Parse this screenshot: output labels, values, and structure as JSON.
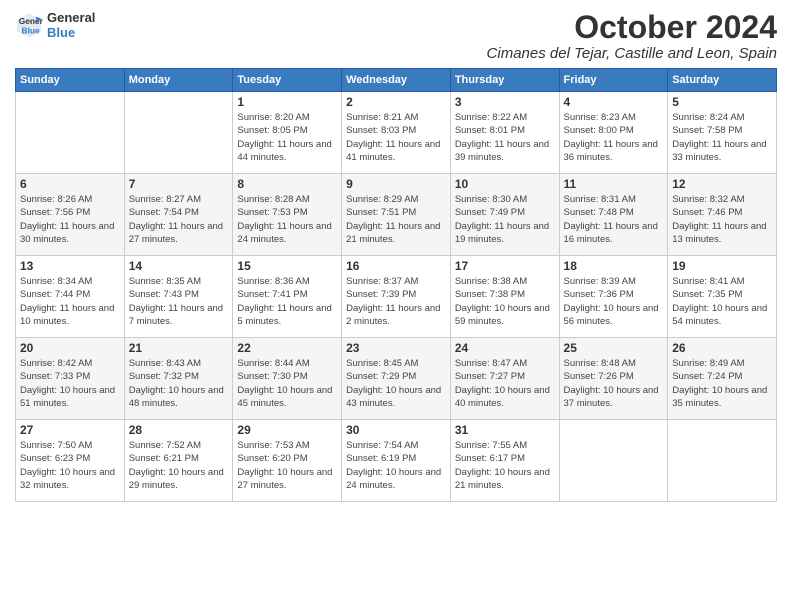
{
  "logo": {
    "line1": "General",
    "line2": "Blue"
  },
  "title": "October 2024",
  "subtitle": "Cimanes del Tejar, Castille and Leon, Spain",
  "days_of_week": [
    "Sunday",
    "Monday",
    "Tuesday",
    "Wednesday",
    "Thursday",
    "Friday",
    "Saturday"
  ],
  "weeks": [
    [
      {
        "day": "",
        "sunrise": "",
        "sunset": "",
        "daylight": ""
      },
      {
        "day": "",
        "sunrise": "",
        "sunset": "",
        "daylight": ""
      },
      {
        "day": "1",
        "sunrise": "Sunrise: 8:20 AM",
        "sunset": "Sunset: 8:05 PM",
        "daylight": "Daylight: 11 hours and 44 minutes."
      },
      {
        "day": "2",
        "sunrise": "Sunrise: 8:21 AM",
        "sunset": "Sunset: 8:03 PM",
        "daylight": "Daylight: 11 hours and 41 minutes."
      },
      {
        "day": "3",
        "sunrise": "Sunrise: 8:22 AM",
        "sunset": "Sunset: 8:01 PM",
        "daylight": "Daylight: 11 hours and 39 minutes."
      },
      {
        "day": "4",
        "sunrise": "Sunrise: 8:23 AM",
        "sunset": "Sunset: 8:00 PM",
        "daylight": "Daylight: 11 hours and 36 minutes."
      },
      {
        "day": "5",
        "sunrise": "Sunrise: 8:24 AM",
        "sunset": "Sunset: 7:58 PM",
        "daylight": "Daylight: 11 hours and 33 minutes."
      }
    ],
    [
      {
        "day": "6",
        "sunrise": "Sunrise: 8:26 AM",
        "sunset": "Sunset: 7:56 PM",
        "daylight": "Daylight: 11 hours and 30 minutes."
      },
      {
        "day": "7",
        "sunrise": "Sunrise: 8:27 AM",
        "sunset": "Sunset: 7:54 PM",
        "daylight": "Daylight: 11 hours and 27 minutes."
      },
      {
        "day": "8",
        "sunrise": "Sunrise: 8:28 AM",
        "sunset": "Sunset: 7:53 PM",
        "daylight": "Daylight: 11 hours and 24 minutes."
      },
      {
        "day": "9",
        "sunrise": "Sunrise: 8:29 AM",
        "sunset": "Sunset: 7:51 PM",
        "daylight": "Daylight: 11 hours and 21 minutes."
      },
      {
        "day": "10",
        "sunrise": "Sunrise: 8:30 AM",
        "sunset": "Sunset: 7:49 PM",
        "daylight": "Daylight: 11 hours and 19 minutes."
      },
      {
        "day": "11",
        "sunrise": "Sunrise: 8:31 AM",
        "sunset": "Sunset: 7:48 PM",
        "daylight": "Daylight: 11 hours and 16 minutes."
      },
      {
        "day": "12",
        "sunrise": "Sunrise: 8:32 AM",
        "sunset": "Sunset: 7:46 PM",
        "daylight": "Daylight: 11 hours and 13 minutes."
      }
    ],
    [
      {
        "day": "13",
        "sunrise": "Sunrise: 8:34 AM",
        "sunset": "Sunset: 7:44 PM",
        "daylight": "Daylight: 11 hours and 10 minutes."
      },
      {
        "day": "14",
        "sunrise": "Sunrise: 8:35 AM",
        "sunset": "Sunset: 7:43 PM",
        "daylight": "Daylight: 11 hours and 7 minutes."
      },
      {
        "day": "15",
        "sunrise": "Sunrise: 8:36 AM",
        "sunset": "Sunset: 7:41 PM",
        "daylight": "Daylight: 11 hours and 5 minutes."
      },
      {
        "day": "16",
        "sunrise": "Sunrise: 8:37 AM",
        "sunset": "Sunset: 7:39 PM",
        "daylight": "Daylight: 11 hours and 2 minutes."
      },
      {
        "day": "17",
        "sunrise": "Sunrise: 8:38 AM",
        "sunset": "Sunset: 7:38 PM",
        "daylight": "Daylight: 10 hours and 59 minutes."
      },
      {
        "day": "18",
        "sunrise": "Sunrise: 8:39 AM",
        "sunset": "Sunset: 7:36 PM",
        "daylight": "Daylight: 10 hours and 56 minutes."
      },
      {
        "day": "19",
        "sunrise": "Sunrise: 8:41 AM",
        "sunset": "Sunset: 7:35 PM",
        "daylight": "Daylight: 10 hours and 54 minutes."
      }
    ],
    [
      {
        "day": "20",
        "sunrise": "Sunrise: 8:42 AM",
        "sunset": "Sunset: 7:33 PM",
        "daylight": "Daylight: 10 hours and 51 minutes."
      },
      {
        "day": "21",
        "sunrise": "Sunrise: 8:43 AM",
        "sunset": "Sunset: 7:32 PM",
        "daylight": "Daylight: 10 hours and 48 minutes."
      },
      {
        "day": "22",
        "sunrise": "Sunrise: 8:44 AM",
        "sunset": "Sunset: 7:30 PM",
        "daylight": "Daylight: 10 hours and 45 minutes."
      },
      {
        "day": "23",
        "sunrise": "Sunrise: 8:45 AM",
        "sunset": "Sunset: 7:29 PM",
        "daylight": "Daylight: 10 hours and 43 minutes."
      },
      {
        "day": "24",
        "sunrise": "Sunrise: 8:47 AM",
        "sunset": "Sunset: 7:27 PM",
        "daylight": "Daylight: 10 hours and 40 minutes."
      },
      {
        "day": "25",
        "sunrise": "Sunrise: 8:48 AM",
        "sunset": "Sunset: 7:26 PM",
        "daylight": "Daylight: 10 hours and 37 minutes."
      },
      {
        "day": "26",
        "sunrise": "Sunrise: 8:49 AM",
        "sunset": "Sunset: 7:24 PM",
        "daylight": "Daylight: 10 hours and 35 minutes."
      }
    ],
    [
      {
        "day": "27",
        "sunrise": "Sunrise: 7:50 AM",
        "sunset": "Sunset: 6:23 PM",
        "daylight": "Daylight: 10 hours and 32 minutes."
      },
      {
        "day": "28",
        "sunrise": "Sunrise: 7:52 AM",
        "sunset": "Sunset: 6:21 PM",
        "daylight": "Daylight: 10 hours and 29 minutes."
      },
      {
        "day": "29",
        "sunrise": "Sunrise: 7:53 AM",
        "sunset": "Sunset: 6:20 PM",
        "daylight": "Daylight: 10 hours and 27 minutes."
      },
      {
        "day": "30",
        "sunrise": "Sunrise: 7:54 AM",
        "sunset": "Sunset: 6:19 PM",
        "daylight": "Daylight: 10 hours and 24 minutes."
      },
      {
        "day": "31",
        "sunrise": "Sunrise: 7:55 AM",
        "sunset": "Sunset: 6:17 PM",
        "daylight": "Daylight: 10 hours and 21 minutes."
      },
      {
        "day": "",
        "sunrise": "",
        "sunset": "",
        "daylight": ""
      },
      {
        "day": "",
        "sunrise": "",
        "sunset": "",
        "daylight": ""
      }
    ]
  ]
}
